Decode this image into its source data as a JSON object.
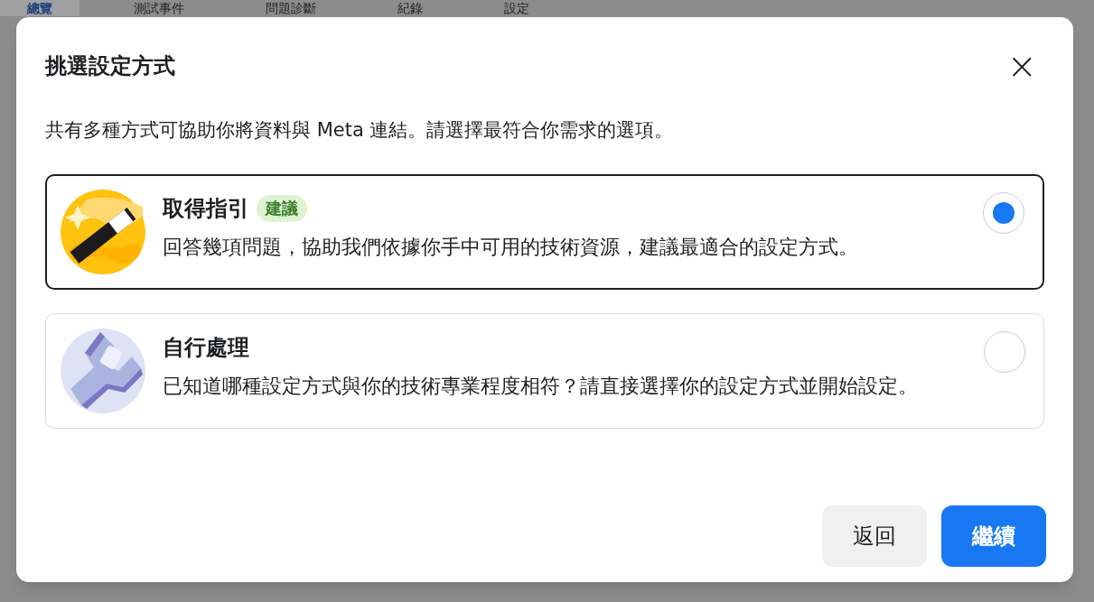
{
  "background_tabs": [
    {
      "label": "總覽",
      "selected": true
    },
    {
      "label": "測試事件",
      "selected": false
    },
    {
      "label": "問題診斷",
      "selected": false
    },
    {
      "label": "紀錄",
      "selected": false
    },
    {
      "label": "設定",
      "selected": false
    }
  ],
  "dialog": {
    "title": "挑選設定方式",
    "close": "×",
    "intro": "共有多種方式可協助你將資料與 Meta 連結。請選擇最符合你需求的選項。",
    "options": [
      {
        "kind": "wand",
        "title": "取得指引",
        "badge": "建議",
        "description": "回答幾項問題，協助我們依據你手中可用的技術資源，建議最適合的設定方式。",
        "selected": true
      },
      {
        "kind": "wrench",
        "title": "自行處理",
        "description": "已知道哪種設定方式與你的技術專業程度相符？請直接選擇你的設定方式並開始設定。",
        "selected": false
      }
    ],
    "buttons": [
      {
        "label": "返回",
        "kind": "secondary"
      },
      {
        "label": "繼續",
        "kind": "primary"
      }
    ]
  }
}
